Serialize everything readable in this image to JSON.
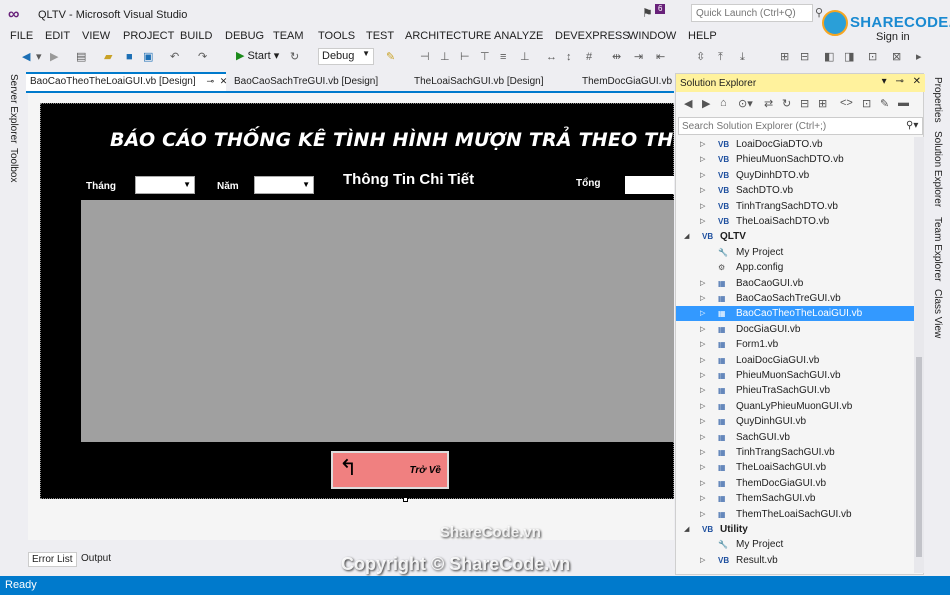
{
  "window": {
    "title": "QLTV - Microsoft Visual Studio",
    "notification_count": "6"
  },
  "quick_launch": {
    "placeholder": "Quick Launch (Ctrl+Q)"
  },
  "branding": {
    "logo_text": "SHARECODE.vn",
    "sign_in": "Sign in"
  },
  "menu": [
    "FILE",
    "EDIT",
    "VIEW",
    "PROJECT",
    "BUILD",
    "DEBUG",
    "TEAM",
    "TOOLS",
    "TEST",
    "ARCHITECTURE",
    "ANALYZE",
    "DEVEXPRESS",
    "WINDOW",
    "HELP"
  ],
  "toolbar": {
    "start_label": "Start",
    "config_value": "Debug"
  },
  "left_tabs": [
    "Server Explorer",
    "Toolbox"
  ],
  "doc_tabs": [
    {
      "label": "BaoCaoTheoTheLoaiGUI.vb [Design]",
      "active": true
    },
    {
      "label": "BaoCaoSachTreGUI.vb [Design]",
      "active": false
    },
    {
      "label": "TheLoaiSachGUI.vb [Design]",
      "active": false
    },
    {
      "label": "ThemDocGiaGUI.vb",
      "active": false
    }
  ],
  "form": {
    "title": "BÁO CÁO THỐNG KÊ TÌNH HÌNH MƯỢN TRẢ THEO THỂ LO",
    "month_label": "Tháng",
    "year_label": "Năm",
    "detail_label": "Thông Tin Chi Tiết",
    "total_label": "Tổng",
    "back_button": "Trở Về"
  },
  "bottom_tabs": [
    "Error List",
    "Output"
  ],
  "solution_explorer": {
    "title": "Solution Explorer",
    "search_placeholder": "Search Solution Explorer (Ctrl+;)",
    "items": [
      {
        "label": "LoaiDocGiaDTO.vb",
        "type": "vb",
        "level": 2,
        "expandable": true
      },
      {
        "label": "PhieuMuonSachDTO.vb",
        "type": "vb",
        "level": 2,
        "expandable": true
      },
      {
        "label": "QuyDinhDTO.vb",
        "type": "vb",
        "level": 2,
        "expandable": true
      },
      {
        "label": "SachDTO.vb",
        "type": "vb",
        "level": 2,
        "expandable": true
      },
      {
        "label": "TinhTrangSachDTO.vb",
        "type": "vb",
        "level": 2,
        "expandable": true
      },
      {
        "label": "TheLoaiSachDTO.vb",
        "type": "vb",
        "level": 2,
        "expandable": true
      },
      {
        "label": "QLTV",
        "type": "project",
        "level": 1,
        "expandable": true,
        "expanded": true
      },
      {
        "label": "My Project",
        "type": "wrench",
        "level": 2,
        "expandable": false
      },
      {
        "label": "App.config",
        "type": "config",
        "level": 2,
        "expandable": false
      },
      {
        "label": "BaoCaoGUI.vb",
        "type": "form",
        "level": 2,
        "expandable": true
      },
      {
        "label": "BaoCaoSachTreGUI.vb",
        "type": "form",
        "level": 2,
        "expandable": true
      },
      {
        "label": "BaoCaoTheoTheLoaiGUI.vb",
        "type": "form",
        "level": 2,
        "expandable": true,
        "selected": true
      },
      {
        "label": "DocGiaGUI.vb",
        "type": "form",
        "level": 2,
        "expandable": true
      },
      {
        "label": "Form1.vb",
        "type": "form",
        "level": 2,
        "expandable": true
      },
      {
        "label": "LoaiDocGiaGUI.vb",
        "type": "form",
        "level": 2,
        "expandable": true
      },
      {
        "label": "PhieuMuonSachGUI.vb",
        "type": "form",
        "level": 2,
        "expandable": true
      },
      {
        "label": "PhieuTraSachGUI.vb",
        "type": "form",
        "level": 2,
        "expandable": true
      },
      {
        "label": "QuanLyPhieuMuonGUI.vb",
        "type": "form",
        "level": 2,
        "expandable": true
      },
      {
        "label": "QuyDinhGUI.vb",
        "type": "form",
        "level": 2,
        "expandable": true
      },
      {
        "label": "SachGUI.vb",
        "type": "form",
        "level": 2,
        "expandable": true
      },
      {
        "label": "TinhTrangSachGUI.vb",
        "type": "form",
        "level": 2,
        "expandable": true
      },
      {
        "label": "TheLoaiSachGUI.vb",
        "type": "form",
        "level": 2,
        "expandable": true
      },
      {
        "label": "ThemDocGiaGUI.vb",
        "type": "form",
        "level": 2,
        "expandable": true
      },
      {
        "label": "ThemSachGUI.vb",
        "type": "form",
        "level": 2,
        "expandable": true
      },
      {
        "label": "ThemTheLoaiSachGUI.vb",
        "type": "form",
        "level": 2,
        "expandable": true
      },
      {
        "label": "Utility",
        "type": "project",
        "level": 1,
        "expandable": true,
        "expanded": true
      },
      {
        "label": "My Project",
        "type": "wrench",
        "level": 2,
        "expandable": false
      },
      {
        "label": "Result.vb",
        "type": "vb",
        "level": 2,
        "expandable": true
      }
    ]
  },
  "right_tabs": [
    "Properties",
    "Solution Explorer",
    "Team Explorer",
    "Class View"
  ],
  "status": {
    "text": "Ready"
  },
  "watermark": {
    "top": "ShareCode.vn",
    "bottom": "Copyright © ShareCode.vn"
  },
  "colors": {
    "accent": "#007acc",
    "vs_purple": "#68217a",
    "se_header": "#fff29d",
    "selection": "#3399ff",
    "back_button": "#f08080"
  }
}
